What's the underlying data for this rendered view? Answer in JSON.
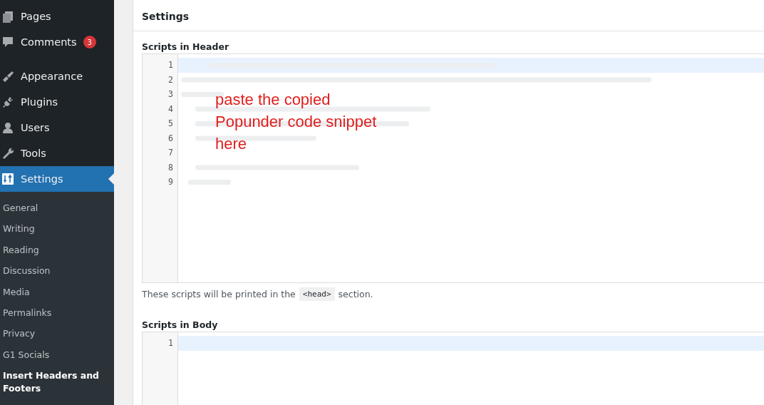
{
  "sidebar": {
    "items": [
      {
        "kind": "pages",
        "label": "Pages",
        "selected": false
      },
      {
        "kind": "comments",
        "label": "Comments",
        "badge": "3",
        "selected": false
      },
      {
        "kind": "appearance",
        "label": "Appearance",
        "selected": false
      },
      {
        "kind": "plugins",
        "label": "Plugins",
        "selected": false
      },
      {
        "kind": "users",
        "label": "Users",
        "selected": false
      },
      {
        "kind": "tools",
        "label": "Tools",
        "selected": false
      },
      {
        "kind": "settings",
        "label": "Settings",
        "selected": true
      }
    ],
    "submenu": [
      {
        "label": "General",
        "selected": false
      },
      {
        "label": "Writing",
        "selected": false
      },
      {
        "label": "Reading",
        "selected": false
      },
      {
        "label": "Discussion",
        "selected": false
      },
      {
        "label": "Media",
        "selected": false
      },
      {
        "label": "Permalinks",
        "selected": false
      },
      {
        "label": "Privacy",
        "selected": false
      },
      {
        "label": "G1 Socials",
        "selected": false
      },
      {
        "label": "Insert Headers and Footers",
        "selected": true
      }
    ]
  },
  "panel": {
    "title": "Settings",
    "header_scripts": {
      "label": "Scripts in Header",
      "line_numbers": [
        "1",
        "2",
        "3",
        "4",
        "5",
        "6",
        "7",
        "8",
        "9"
      ],
      "code_blurred": true,
      "help_before": "These scripts will be printed in the",
      "help_code": "<head>",
      "help_after": "section."
    },
    "body_scripts": {
      "label": "Scripts in Body",
      "line_numbers": [
        "1"
      ]
    }
  },
  "annotation": "paste the copied Popunder code snippet here"
}
